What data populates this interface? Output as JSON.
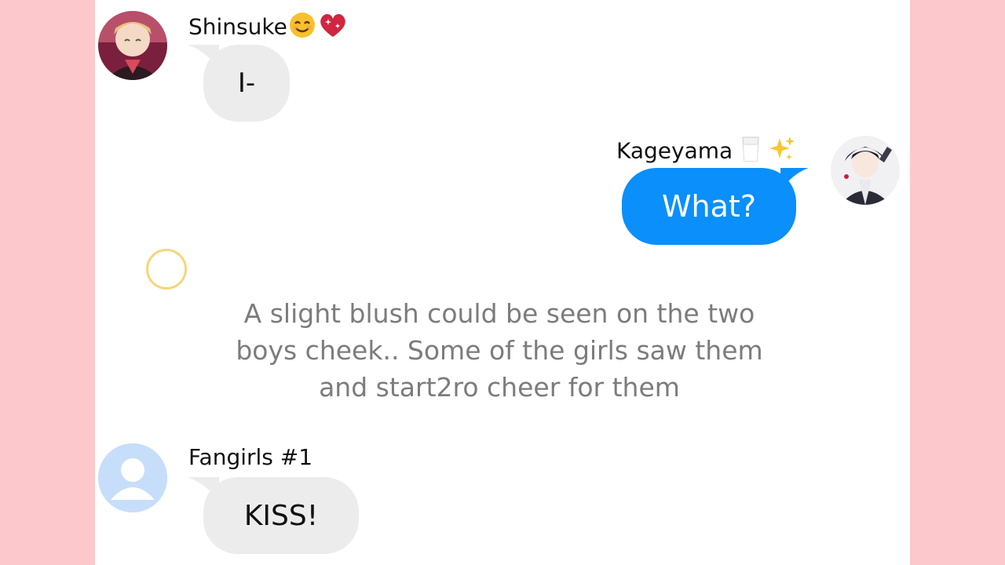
{
  "messages": [
    {
      "sender": "Shinsuke",
      "sender_emoji": [
        "smiling-face-emoji",
        "sparkling-heart-emoji"
      ],
      "text": "I-",
      "side": "left"
    },
    {
      "sender": "Kageyama",
      "sender_emoji": [
        "milk-glass-emoji",
        "sparkles-emoji"
      ],
      "text": "What?",
      "side": "right"
    },
    {
      "sender": "Fangirls #1",
      "text": "KISS!",
      "side": "left"
    }
  ],
  "narration": {
    "line1": "A slight blush could be seen on the two",
    "line2": "boys cheek.. Some of the girls saw them",
    "line3": "and start2ro cheer for them"
  },
  "colors": {
    "page_background": "#fcc8cb",
    "incoming_bubble": "#ececec",
    "outgoing_bubble": "#0a8ffb",
    "narration_text": "#7c7c7c",
    "ring": "#f7d57a",
    "default_avatar": "#c7defa"
  }
}
